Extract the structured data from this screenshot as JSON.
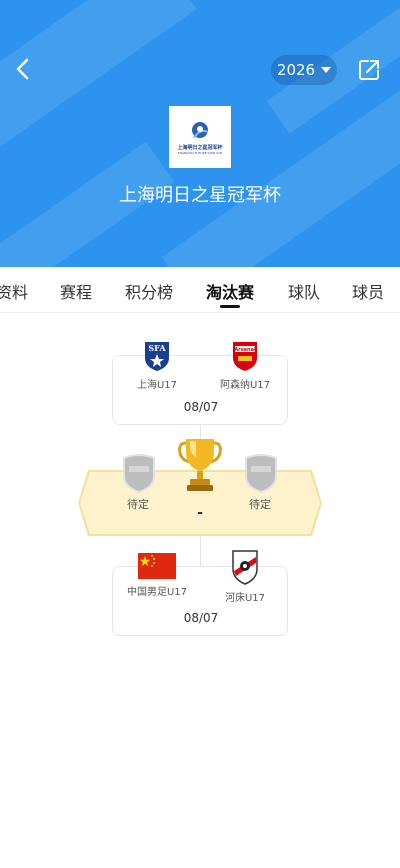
{
  "header": {
    "year": "2026",
    "title": "上海明日之星冠军杯",
    "logo_text": "上海明日之星冠军杯",
    "logo_subtext": "SHANGHAI FUTURE STAR CUP",
    "bg_color": "#2d93ee"
  },
  "tabs": [
    {
      "label": "资料"
    },
    {
      "label": "赛程"
    },
    {
      "label": "积分榜"
    },
    {
      "label": "淘汰赛",
      "active": true
    },
    {
      "label": "球队"
    },
    {
      "label": "球员"
    }
  ],
  "bracket": {
    "semi1": {
      "home": {
        "name": "上海U17",
        "crest": "sfa-crest-icon"
      },
      "away": {
        "name": "阿森纳U17",
        "crest": "arsenal-crest-icon"
      },
      "date": "08/07"
    },
    "final": {
      "home": {
        "name": "待定"
      },
      "away": {
        "name": "待定"
      },
      "score": "-"
    },
    "semi2": {
      "home": {
        "name": "中国男足U17",
        "crest": "china-flag-icon"
      },
      "away": {
        "name": "河床U17",
        "crest": "river-plate-crest-icon"
      },
      "date": "08/07"
    }
  },
  "icons": {
    "back": "chevron-left-icon",
    "dropdown": "caret-down-icon",
    "share": "share-icon",
    "trophy": "trophy-icon"
  }
}
